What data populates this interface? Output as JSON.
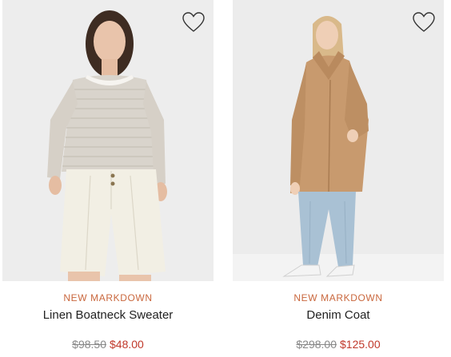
{
  "products": [
    {
      "badge": "NEW MARKDOWN",
      "name": "Linen Boatneck Sweater",
      "original_price": "$98.50",
      "sale_price": "$48.00",
      "wishlist_icon": "heart-outline-icon"
    },
    {
      "badge": "NEW MARKDOWN",
      "name": "Denim Coat",
      "original_price": "$298.00",
      "sale_price": "$125.00",
      "wishlist_icon": "heart-outline-icon"
    }
  ],
  "colors": {
    "badge": "#c9673d",
    "sale_price": "#c0392b",
    "original_price": "#888888"
  }
}
